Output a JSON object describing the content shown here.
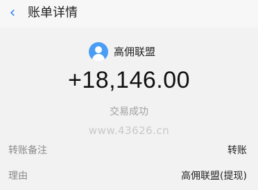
{
  "header": {
    "back_icon": "chevron-left-icon",
    "title": "账单详情"
  },
  "summary": {
    "avatar_icon": "user-avatar-icon",
    "payer_name": "高佣联盟",
    "amount": "+18,146.00",
    "status": "交易成功"
  },
  "watermark": "www.43626.cn",
  "details": [
    {
      "label": "转账备注",
      "value": "转账"
    },
    {
      "label": "理由",
      "value": "高佣联盟(提现)"
    }
  ],
  "colors": {
    "accent": "#2b82f5",
    "avatar": "#4a9df5",
    "status_text": "#a0a0a0"
  }
}
